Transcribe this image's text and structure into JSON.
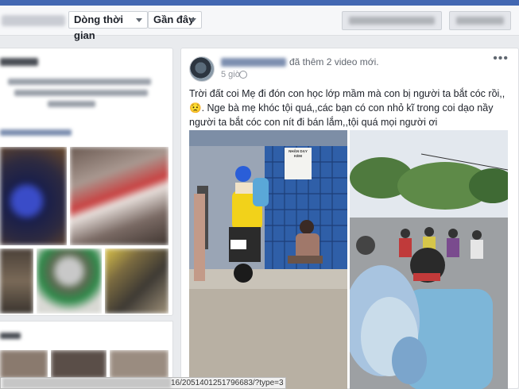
{
  "timeline": {
    "dropdown_order": "Dòng thời gian",
    "dropdown_recent": "Gần đây"
  },
  "left_column": {
    "intro_heading": "Giới thiệu",
    "photos_heading": "Ảnh",
    "friends_heading": "Bạn bè"
  },
  "post": {
    "added_text": "đã thêm 2 video mới.",
    "time": "5 giờ",
    "text": "Trời đất coi Mẹ đi đón con học lớp mầm mà con bị người ta bắt cóc rồi,,😟. Nge bà mẹ khóc tội quá,,các bạn có con nhỏ kĩ trong coi dạo nầy người ta bắt cóc con nít đi bán lắm,,tội quá mọi người ơi",
    "more_label": "•••",
    "video_sign_text": "NHẬN DẠY KÈM"
  },
  "status_bar": {
    "url_suffix": "16/2051401251796683/?type=3"
  },
  "colors": {
    "brand_blue": "#4267b2",
    "page_bg": "#e9ebee"
  }
}
